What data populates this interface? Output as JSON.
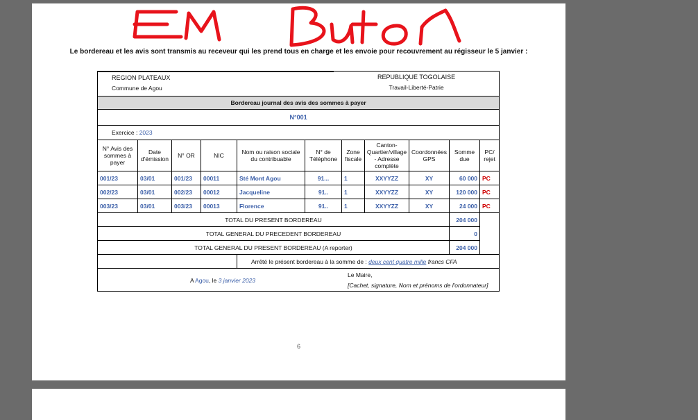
{
  "handwriting": "EM Buton",
  "intro": "Le bordereau et les avis sont transmis au receveur qui les prend tous en charge et les envoie pour recouvrement au régisseur le 5 janvier :",
  "header": {
    "region": "REGION PLATEAUX",
    "commune": "Commune de Agou",
    "republic": "REPUBLIQUE TOGOLAISE",
    "motto": "Travail-Liberté-Patrie"
  },
  "title": "Bordereau journal des avis des sommes à payer",
  "number": "N°001",
  "exercice_label": "Exercice : ",
  "exercice_year": "2023",
  "columns": [
    "N° Avis des sommes à payer",
    "Date d'émission",
    "N° OR",
    "NIC",
    "Nom ou raison sociale du contribuable",
    "N° de Téléphone",
    "Zone fiscale",
    "Canton-Quartier/village - Adresse complète",
    "Coordonnées GPS",
    "Somme due",
    "PC/ rejet"
  ],
  "rows": [
    [
      "001/23",
      "03/01",
      "001/23",
      "00011",
      "Sté Mont Agou",
      "91...",
      "1",
      "XXYYZZ",
      "XY",
      "60 000",
      "PC"
    ],
    [
      "002/23",
      "03/01",
      "002/23",
      "00012",
      "Jacqueline",
      "91..",
      "1",
      "XXYYZZ",
      "XY",
      "120 000",
      "PC"
    ],
    [
      "003/23",
      "03/01",
      "003/23",
      "00013",
      "Florence",
      "91..",
      "1",
      "XXYYZZ",
      "XY",
      "24 000",
      "PC"
    ]
  ],
  "totals": [
    {
      "label": "TOTAL DU PRESENT BORDEREAU",
      "value": "204 000"
    },
    {
      "label": "TOTAL GENERAL DU PRECEDENT BORDEREAU",
      "value": "0"
    },
    {
      "label": "TOTAL GENERAL DU PRESENT BORDEREAU (A reporter)",
      "value": "204 000"
    }
  ],
  "arrete": {
    "prefix": "Arrêté le présent bordereau à la somme de : ",
    "amount_words": "deux cent quatre mille",
    "suffix": " francs CFA"
  },
  "signature": {
    "place_prefix": "A ",
    "place": "Agou",
    "le": ", le ",
    "date": "3 janvier 2023",
    "title": "Le Maire,",
    "note": "[Cachet, signature, Nom et prénoms de l'ordonnateur]"
  },
  "page_number": "6",
  "colors": {
    "accent_blue": "#3a5ea8",
    "red": "#d00000",
    "handwriting": "#e8131b"
  }
}
